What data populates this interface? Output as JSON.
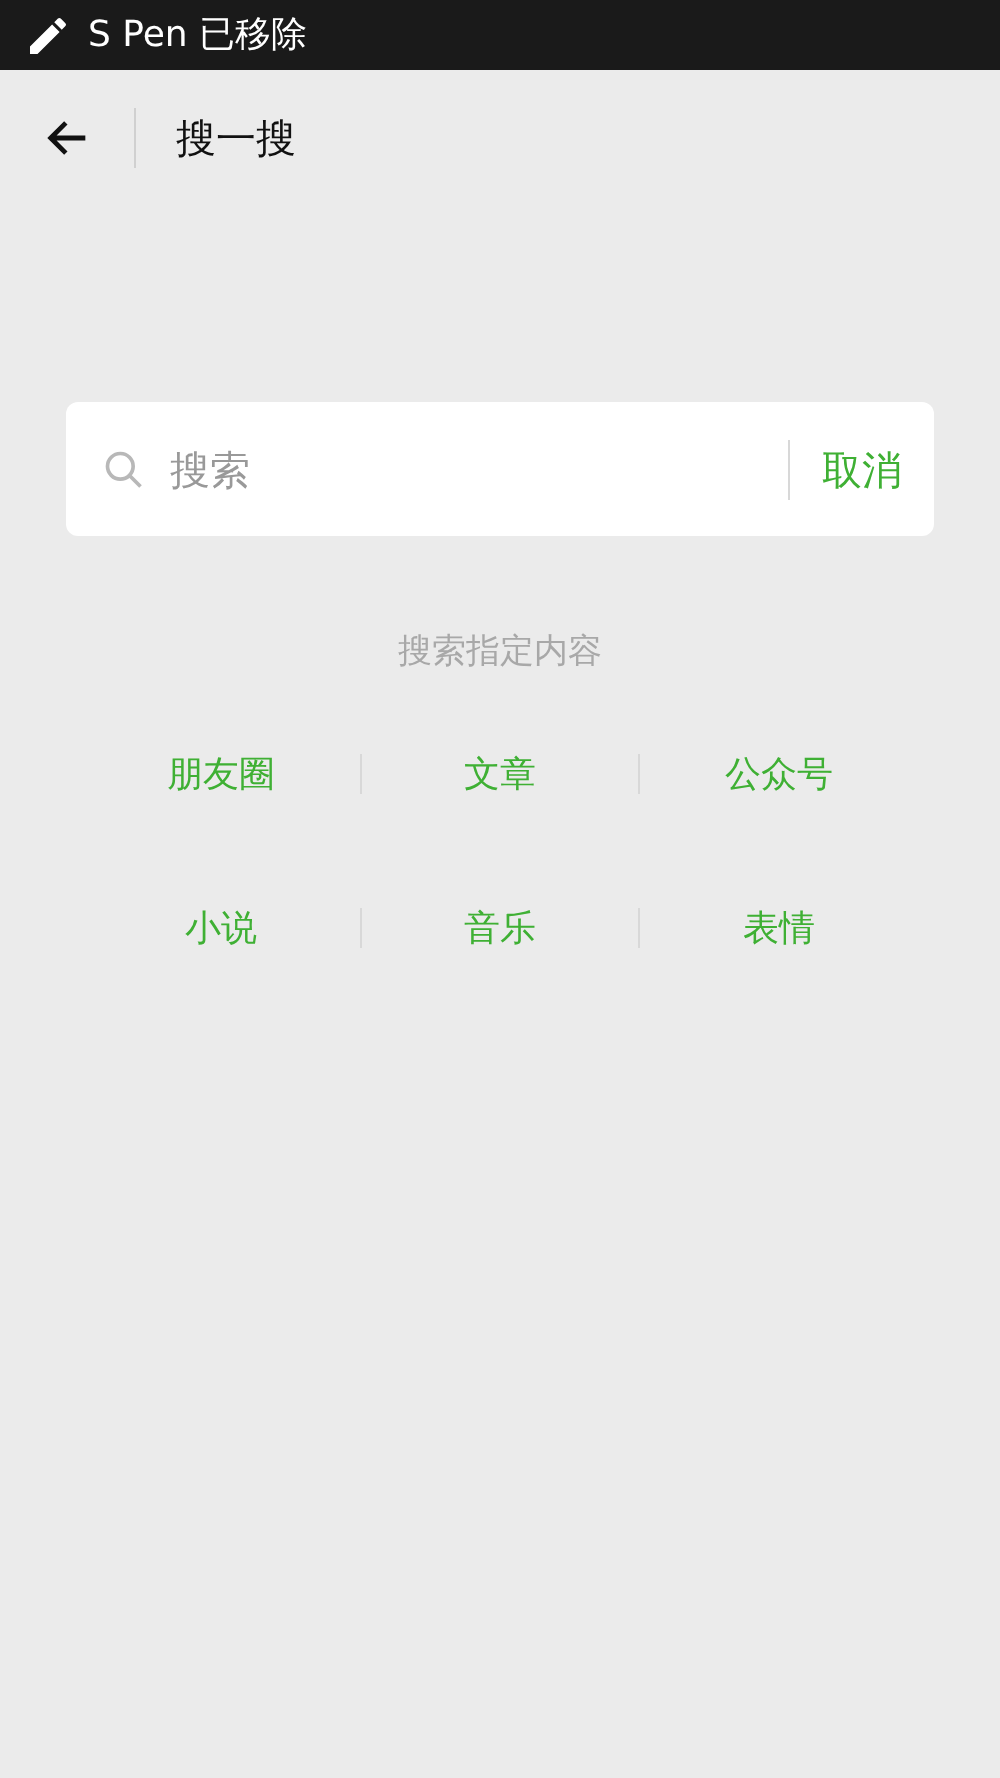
{
  "status_bar": {
    "text": "S Pen 已移除"
  },
  "header": {
    "title": "搜一搜"
  },
  "search": {
    "placeholder": "搜索",
    "cancel": "取消"
  },
  "hint": "搜索指定内容",
  "categories": [
    [
      "朋友圈",
      "文章",
      "公众号"
    ],
    [
      "小说",
      "音乐",
      "表情"
    ]
  ]
}
